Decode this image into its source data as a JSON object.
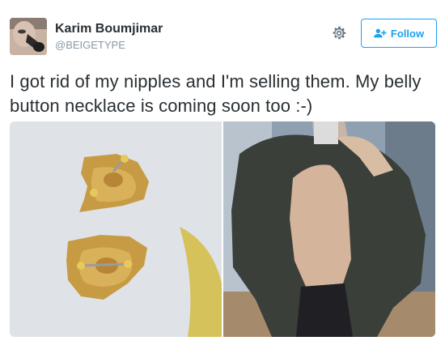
{
  "user": {
    "display_name": "Karim Boumjimar",
    "handle": "@BEIGETYPE"
  },
  "actions": {
    "follow_label": "Follow",
    "settings_icon": "gear-icon",
    "follow_icon": "add-user-icon"
  },
  "tweet": {
    "text": "I got rid of my nipples and I'm selling them. My belly button necklace is coming soon too :-)"
  },
  "colors": {
    "accent": "#1da1f2",
    "text": "#292f33",
    "muted": "#8899a6"
  }
}
